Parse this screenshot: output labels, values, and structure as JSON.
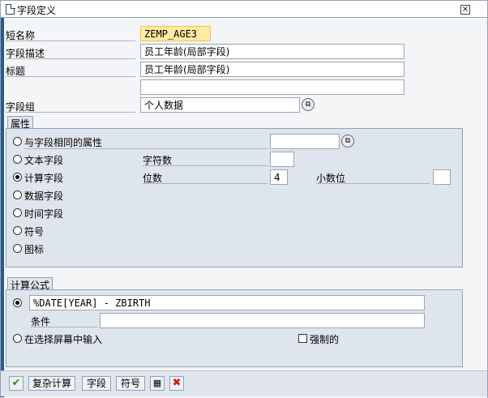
{
  "window": {
    "title": "字段定义",
    "close_glyph": "×"
  },
  "form": {
    "short_name_label": "短名称",
    "short_name_value": "ZEMP_AGE3",
    "desc_label": "字段描述",
    "desc_value": "员工年龄(局部字段)",
    "heading_label": "标题",
    "heading_value": "员工年龄(局部字段)",
    "heading_value2": "",
    "group_label": "字段组",
    "group_value": "个人数据"
  },
  "attributes": {
    "section_label": "属性",
    "same_attr_label": "与字段相同的属性",
    "text_field_label": "文本字段",
    "char_count_label": "字符数",
    "calc_field_label": "计算字段",
    "digits_label": "位数",
    "digits_value": "4",
    "decimals_label": "小数位",
    "date_field_label": "数据字段",
    "time_field_label": "时间字段",
    "symbol_label": "符号",
    "icon_label": "图标"
  },
  "formula": {
    "section_label": "计算公式",
    "expression": "%DATE[YEAR] - ZBIRTH",
    "condition_label": "条件",
    "condition_value": "",
    "input_on_screen_label": "在选择屏幕中输入",
    "mandatory_label": "强制的"
  },
  "toolbar": {
    "complex_calc_label": "复杂计算",
    "field_label": "字段",
    "symbol_label": "符号"
  },
  "colors": {
    "accent": "#2d5a8a",
    "ok_green": "#2e8b2e",
    "cancel_red": "#cc1a1a",
    "highlight_yellow": "#ffeaa0"
  }
}
